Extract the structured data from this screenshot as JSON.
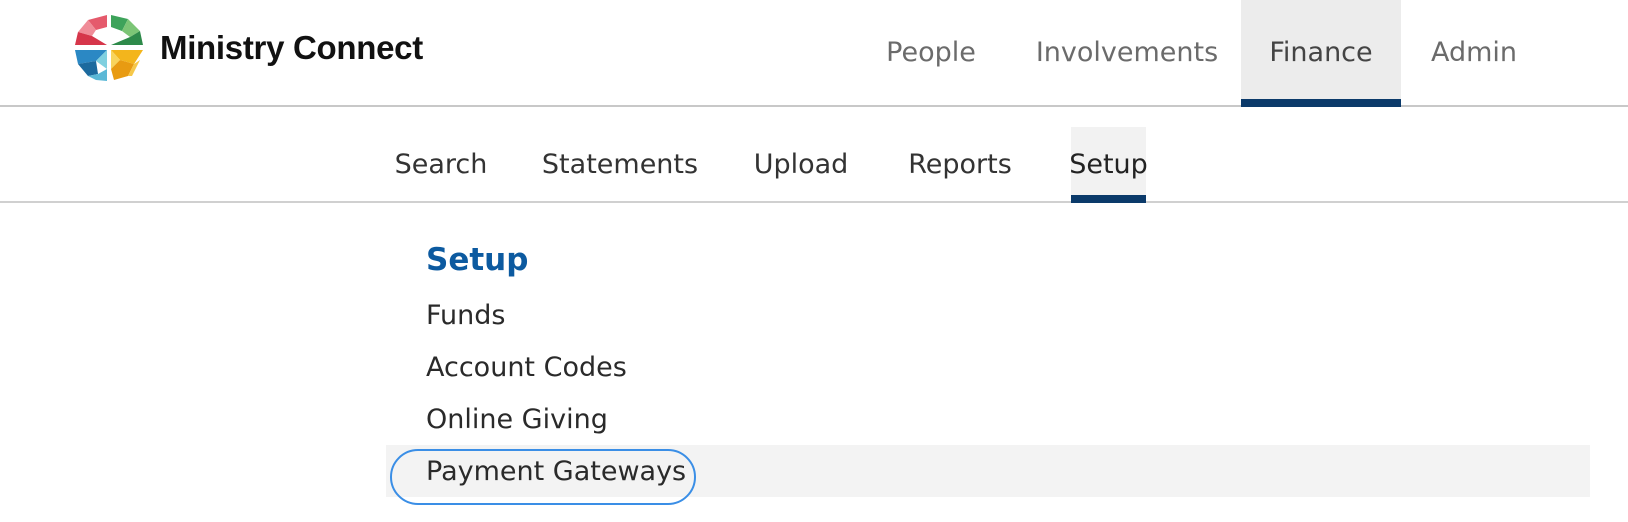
{
  "brand": {
    "name": "Ministry Connect",
    "logo_icon": "ministry-connect-logo-icon"
  },
  "main_nav": {
    "tabs": [
      {
        "label": "People",
        "active": false
      },
      {
        "label": "Involvements",
        "active": false
      },
      {
        "label": "Finance",
        "active": true
      },
      {
        "label": "Admin",
        "active": false
      }
    ]
  },
  "sub_nav": {
    "tabs": [
      {
        "label": "Search",
        "active": false
      },
      {
        "label": "Statements",
        "active": false
      },
      {
        "label": "Upload",
        "active": false
      },
      {
        "label": "Reports",
        "active": false
      },
      {
        "label": "Setup",
        "active": true
      }
    ]
  },
  "setup_menu": {
    "heading": "Setup",
    "items": [
      {
        "label": "Funds"
      },
      {
        "label": "Account Codes"
      },
      {
        "label": "Online Giving"
      },
      {
        "label": "Payment Gateways",
        "hovered": true,
        "focused": true
      }
    ]
  },
  "colors": {
    "active_underline": "#0b3a6a",
    "heading_blue": "#0c5aa0",
    "focus_ring": "#3a8ee6",
    "active_tab_bg": "#ececec"
  }
}
